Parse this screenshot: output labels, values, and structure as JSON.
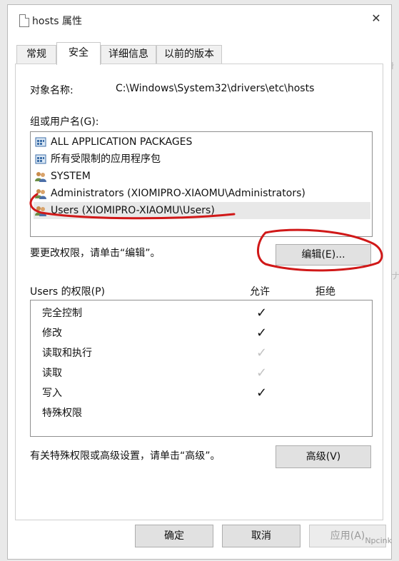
{
  "window": {
    "title": "hosts 属性",
    "close_glyph": "✕"
  },
  "tabs": [
    {
      "label": "常规",
      "active": false
    },
    {
      "label": "安全",
      "active": true
    },
    {
      "label": "详细信息",
      "active": false
    },
    {
      "label": "以前的版本",
      "active": false
    }
  ],
  "security": {
    "object_label": "对象名称:",
    "object_value": "C:\\Windows\\System32\\drivers\\etc\\hosts",
    "groups_label": "组或用户名(G):",
    "groups": [
      {
        "name": "ALL APPLICATION PACKAGES",
        "icon": "package-group-icon"
      },
      {
        "name": "所有受限制的应用程序包",
        "icon": "package-group-icon"
      },
      {
        "name": "SYSTEM",
        "icon": "users-group-icon"
      },
      {
        "name": "Administrators (XIOMIPRO-XIAOMU\\Administrators)",
        "icon": "users-group-icon"
      },
      {
        "name": "Users (XIOMIPRO-XIAOMU\\Users)",
        "icon": "users-group-icon",
        "selected": true
      }
    ],
    "edit_hint": "要更改权限，请单击“编辑”。",
    "edit_button": "编辑(E)...",
    "perm_label": "Users 的权限(P)",
    "allow_header": "允许",
    "deny_header": "拒绝",
    "permissions": [
      {
        "name": "完全控制",
        "allow": "checked"
      },
      {
        "name": "修改",
        "allow": "checked"
      },
      {
        "name": "读取和执行",
        "allow": "inherited"
      },
      {
        "name": "读取",
        "allow": "inherited"
      },
      {
        "name": "写入",
        "allow": "checked"
      },
      {
        "name": "特殊权限",
        "allow": "none"
      }
    ],
    "check_glyph": "✓",
    "advanced_hint": "有关特殊权限或高级设置，请单击“高级”。",
    "advanced_button": "高级(V)"
  },
  "footer": {
    "ok": "确定",
    "cancel": "取消",
    "apply": "应用(A)"
  },
  "watermark": "Npcink",
  "colors": {
    "annotation_red": "#d01818",
    "selected_row": "#e8e8e8"
  }
}
